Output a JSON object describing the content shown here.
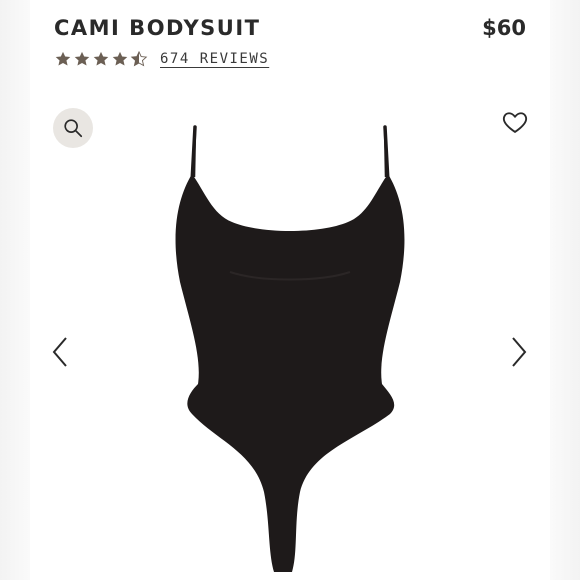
{
  "product": {
    "title": "CAMI BODYSUIT",
    "price": "$60",
    "rating": 4.5,
    "reviews_label": "674 REVIEWS",
    "image_label": "Cami bodysuit product image"
  },
  "icons": {
    "zoom": "search-icon",
    "wishlist": "heart-icon",
    "prev": "chevron-left-icon",
    "next": "chevron-right-icon",
    "star": "star-icon"
  },
  "colors": {
    "star": "#6b5f54",
    "zoom_bg": "#e9e6e2",
    "garment": "#1e1a1a"
  }
}
